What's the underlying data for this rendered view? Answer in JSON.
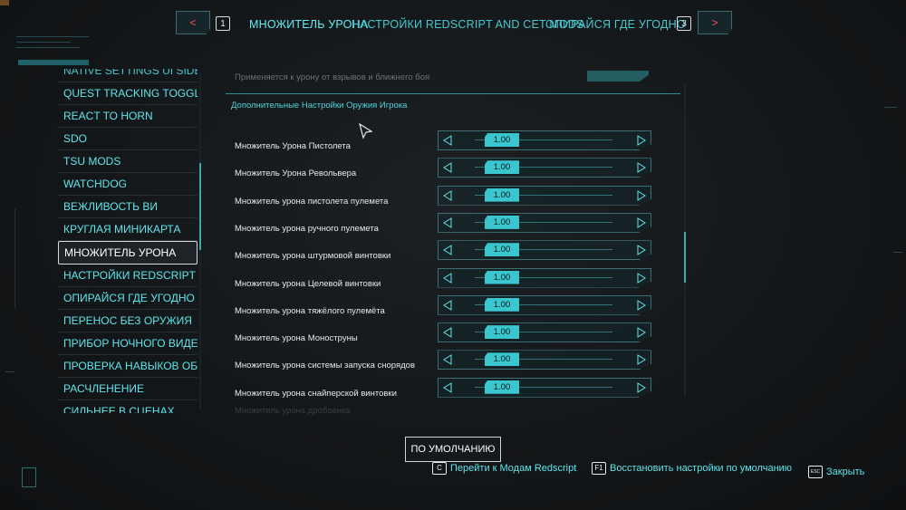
{
  "top_nav": {
    "prev_arrow": "<",
    "prev_key": "1",
    "tabs": [
      {
        "label": "МНОЖИТЕЛЬ УРОНА",
        "active": true
      },
      {
        "label": "НАСТРОЙКИ REDSCRIPT AND CET MODS",
        "active": false
      },
      {
        "label": "ОПИРАЙСЯ ГДЕ УГОДНО",
        "active": false
      }
    ],
    "next_key": "3",
    "next_arrow": ">"
  },
  "sidebar": {
    "items": [
      {
        "label": "NATIVE SETTINGS UI SIDE"
      },
      {
        "label": "QUEST TRACKING TOGGLE"
      },
      {
        "label": "REACT TO HORN"
      },
      {
        "label": "SDO"
      },
      {
        "label": "TSU MODS"
      },
      {
        "label": "WATCHDOG"
      },
      {
        "label": "ВЕЖЛИВОСТЬ ВИ"
      },
      {
        "label": "КРУГЛАЯ МИНИКАРТА"
      },
      {
        "label": "МНОЖИТЕЛЬ УРОНА",
        "selected": true
      },
      {
        "label": "НАСТРОЙКИ REDSCRIPT AND"
      },
      {
        "label": "ОПИРАЙСЯ ГДЕ УГОДНО"
      },
      {
        "label": "ПЕРЕНОС БЕЗ ОРУЖИЯ"
      },
      {
        "label": "ПРИБОР НОЧНОГО ВИДЕНИЯ"
      },
      {
        "label": "ПРОВЕРКА НАВЫКОВ ОБЩЕНИ"
      },
      {
        "label": "РАСЧЛЕНЕНИЕ"
      },
      {
        "label": "СИЛЬНЕЕ В СЦЕНАХ"
      }
    ]
  },
  "panel": {
    "top_cut_label": "Применяется к урону от взрывов и ближнего боя",
    "section_title": "Дополнительные Настройки Оружия Игрока",
    "rows": [
      {
        "label": "Множитель Урона Пистолета",
        "value": "1.00"
      },
      {
        "label": "Множитель Урона Револьвера",
        "value": "1.00"
      },
      {
        "label": "Множитель урона пистолета пулемета",
        "value": "1.00"
      },
      {
        "label": "Множитель урона ручного пулемета",
        "value": "1.00"
      },
      {
        "label": "Множитель урона штурмовой винтовки",
        "value": "1.00"
      },
      {
        "label": "Множитель урона Целевой винтовки",
        "value": "1.00"
      },
      {
        "label": "Множитель урона тяжёлого пулемёта",
        "value": "1.00"
      },
      {
        "label": "Множитель урона Моноструны",
        "value": "1.00"
      },
      {
        "label": "Множитель урона системы запуска снорядов",
        "value": "1.00"
      },
      {
        "label": "Множитель урона снайперской винтовки",
        "value": "1.00"
      }
    ],
    "bottom_cut_label": "Множитель урона дробовика"
  },
  "bottom": {
    "default_button": "ПО УМОЛЧАНИЮ",
    "hints": [
      {
        "key": "C",
        "label": "Перейти к Модам Redscript"
      },
      {
        "key": "F1",
        "label": "Восстановить настройки по умолчанию"
      },
      {
        "key": "ESC",
        "label": "Закрыть"
      }
    ]
  },
  "colors": {
    "accent": "#5ee6ec",
    "knob": "#39c6cf",
    "background": "#16191b",
    "arrow_red": "#ff4d55"
  }
}
